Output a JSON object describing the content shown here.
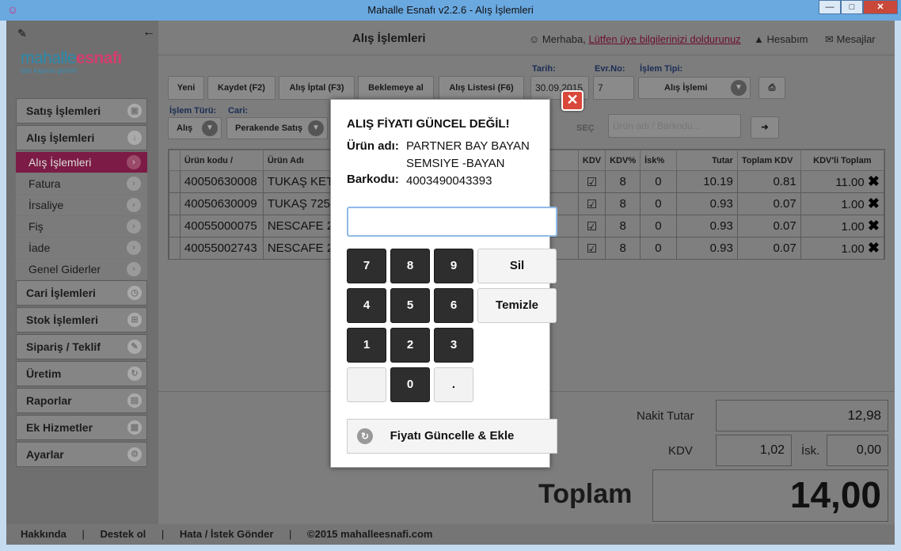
{
  "window": {
    "title": "Mahalle Esnafı v2.2.6 - Alış İşlemleri",
    "minimize": "—",
    "maximize": "□",
    "close": "✕"
  },
  "sidebar": {
    "logo_main_a": "mahalle",
    "logo_main_b": "esnafı",
    "logo_tagline": "işte kapına          gelsin!",
    "groups": [
      {
        "label": "Satış İşlemleri",
        "icon": "bag-icon"
      },
      {
        "label": "Alış İşlemleri",
        "icon": "down-arrow-icon"
      }
    ],
    "subitems": [
      {
        "label": "Alış İşlemleri"
      },
      {
        "label": "Fatura"
      },
      {
        "label": "İrsaliye"
      },
      {
        "label": "Fiş"
      },
      {
        "label": "İade"
      },
      {
        "label": "Genel Giderler"
      }
    ],
    "groups2": [
      {
        "label": "Cari İşlemleri"
      },
      {
        "label": "Stok İşlemleri"
      },
      {
        "label": "Sipariş / Teklif"
      },
      {
        "label": "Üretim"
      },
      {
        "label": "Raporlar"
      },
      {
        "label": "Ek Hizmetler"
      },
      {
        "label": "Ayarlar"
      }
    ]
  },
  "header": {
    "page_title": "Alış İşlemleri",
    "greeting": "Merhaba,",
    "profile_link": "Lütfen üye bilgilerinizi doldurunuz",
    "account": "Hesabım",
    "messages": "Mesajlar"
  },
  "toolbar": {
    "new": "Yeni",
    "save": "Kaydet (F2)",
    "cancel": "Alış İptal (F3)",
    "hold": "Beklemeye al",
    "list": "Alış Listesi (F6)",
    "date_label": "Tarih:",
    "date_value": "30.09.2015",
    "docno_label": "Evr.No:",
    "docno_value": "7",
    "optype_label": "İşlem Tipi:",
    "optype_value": "Alış İşlemi",
    "optype2_label": "İşlem Türü:",
    "optype2_value": "Alış",
    "account_label": "Cari:",
    "account_value": "Perakende Satış",
    "select_label": "SEÇ",
    "search_placeholder": "Ürün adı / Barkodu..."
  },
  "grid": {
    "headers": [
      "Ürün kodu /",
      "Ürün Adı",
      "KDV",
      "KDV%",
      "İsk%",
      "Tutar",
      "Toplam KDV",
      "KDV'li Toplam"
    ],
    "rows": [
      {
        "code": "40050630008",
        "name": "TUKAŞ KET",
        "kdv": "☑",
        "kdvp": "8",
        "isk": "0",
        "tutar": "10.19",
        "tkdv": "0.81",
        "total": "11.00"
      },
      {
        "code": "40050630009",
        "name": "TUKAŞ 725",
        "kdv": "☑",
        "kdvp": "8",
        "isk": "0",
        "tutar": "0.93",
        "tkdv": "0.07",
        "total": "1.00"
      },
      {
        "code": "40055000075",
        "name": "NESCAFE 2",
        "kdv": "☑",
        "kdvp": "8",
        "isk": "0",
        "tutar": "0.93",
        "tkdv": "0.07",
        "total": "1.00"
      },
      {
        "code": "40055002743",
        "name": "NESCAFE 2",
        "kdv": "☑",
        "kdvp": "8",
        "isk": "0",
        "tutar": "0.93",
        "tkdv": "0.07",
        "total": "1.00"
      }
    ]
  },
  "summary": {
    "cash_label": "Nakit Tutar",
    "cash_value": "12,98",
    "kdv_label": "KDV",
    "kdv_value": "1,02",
    "isk_label": "İsk.",
    "isk_value": "0,00",
    "total_label": "Toplam",
    "total_value": "14,00"
  },
  "footer": {
    "about": "Hakkında",
    "support": "Destek ol",
    "report": "Hata / İstek Gönder",
    "copyright": "©2015 mahalleesnafi.com",
    "sep": "|"
  },
  "modal": {
    "title": "ALIŞ FİYATI GÜNCEL DEĞİL!",
    "name_label": "Ürün adı:",
    "name_value": "PARTNER BAY BAYAN SEMSIYE -BAYAN",
    "barcode_label": "Barkodu:",
    "barcode_value": "4003490043393",
    "input_value": "",
    "keys": [
      "7",
      "8",
      "9",
      "4",
      "5",
      "6",
      "1",
      "2",
      "3",
      "",
      "0",
      "."
    ],
    "delete": "Sil",
    "clear": "Temizle",
    "submit": "Fiyatı Güncelle & Ekle",
    "close": "✕"
  }
}
